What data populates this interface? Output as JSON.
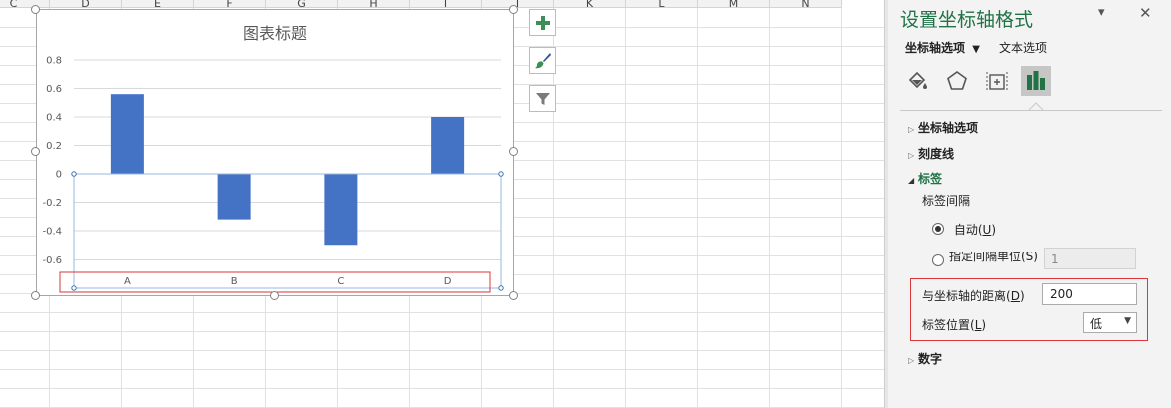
{
  "sheet": {
    "columns": [
      "C",
      "D",
      "E",
      "F",
      "G",
      "H",
      "I",
      "J",
      "K",
      "L",
      "M",
      "N"
    ]
  },
  "chart": {
    "title": "图表标题",
    "y_ticks": [
      "0.8",
      "0.6",
      "0.4",
      "0.2",
      "0",
      "-0.2",
      "-0.4",
      "-0.6"
    ],
    "categories": [
      "A",
      "B",
      "C",
      "D"
    ],
    "bar_color": "#4472c4",
    "highlight_color": "#d9373b"
  },
  "chart_data": {
    "type": "bar",
    "title": "图表标题",
    "categories": [
      "A",
      "B",
      "C",
      "D"
    ],
    "values": [
      0.56,
      -0.32,
      -0.5,
      0.4
    ],
    "ylim": [
      -0.8,
      0.8
    ],
    "grid": true,
    "xlabel": "",
    "ylabel": ""
  },
  "chart_tools": {
    "elements": "plus-icon",
    "styles": "brush-icon",
    "filters": "funnel-icon"
  },
  "pane": {
    "title": "设置坐标轴格式",
    "tab_axis_options": "坐标轴选项",
    "tab_text_options": "文本选项",
    "sections": {
      "axis_options": "坐标轴选项",
      "tick_marks": "刻度线",
      "labels": "标签",
      "number": "数字"
    },
    "label_interval": "标签间隔",
    "auto_prefix": "自动(",
    "auto_key": "U",
    "auto_suffix": ")",
    "specify_label": "指定间隔单位(S)",
    "specify_value": "1",
    "distance_prefix": "与坐标轴的距离(",
    "distance_key": "D",
    "distance_suffix": ")",
    "distance_value": "200",
    "position_prefix": "标签位置(",
    "position_key": "L",
    "position_suffix": ")",
    "position_value": "低",
    "accent_color": "#217346",
    "highlight_color": "#d9373b"
  }
}
